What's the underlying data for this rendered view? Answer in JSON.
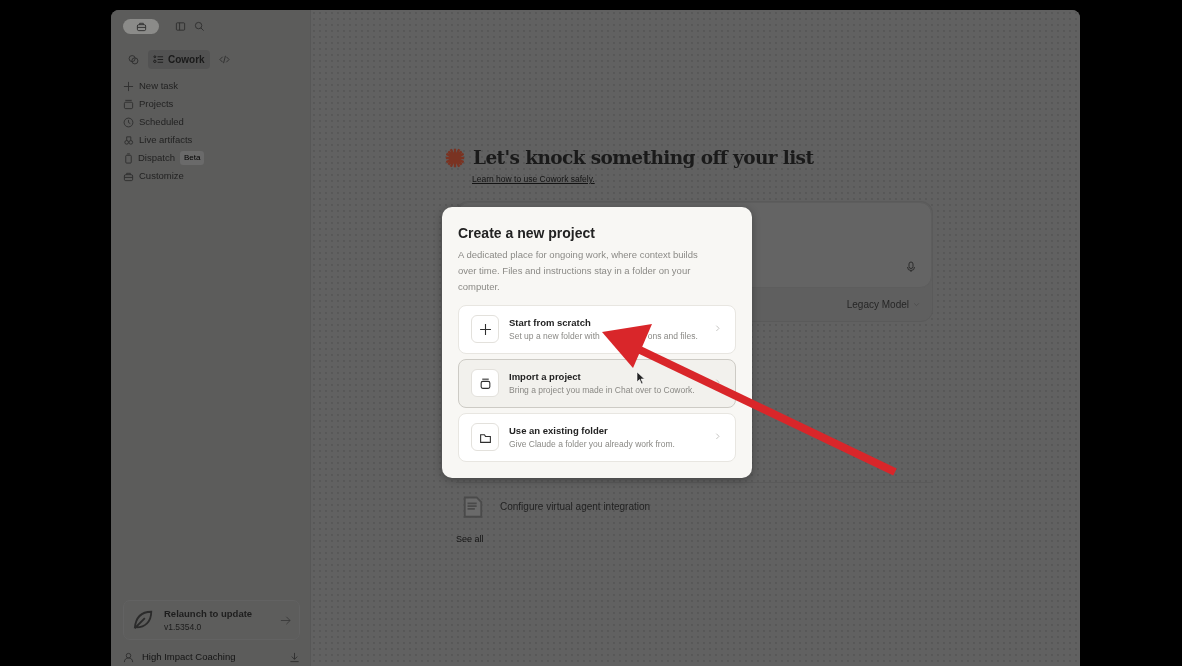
{
  "sidebar": {
    "mode_tabs": [
      {
        "kind": "chat",
        "selected": false
      },
      {
        "kind": "cowork",
        "label": "Cowork",
        "selected": true
      },
      {
        "kind": "code",
        "selected": false
      }
    ],
    "nav_items": [
      {
        "kind": "plus",
        "label": "New task"
      },
      {
        "kind": "projects",
        "label": "Projects"
      },
      {
        "kind": "clock",
        "label": "Scheduled"
      },
      {
        "kind": "artifacts",
        "label": "Live artifacts"
      },
      {
        "kind": "dispatch",
        "label": "Dispatch",
        "badge": "Beta"
      },
      {
        "kind": "customize",
        "label": "Customize"
      }
    ],
    "update_card": {
      "title": "Relaunch to update",
      "version": "v1.5354.0"
    },
    "footer_item": {
      "label": "High Impact Coaching"
    }
  },
  "main": {
    "heading": "Let's knock something off your list",
    "safety_link": "Learn how to use Cowork safely.",
    "composer": {
      "model": "Legacy Model"
    },
    "recent": {
      "items": [
        {
          "label": "Configure virtual agent integration"
        }
      ],
      "see_all": "See all"
    }
  },
  "modal": {
    "title": "Create a new project",
    "description": "A dedicated place for ongoing work, where context builds over time. Files and instructions stay in a folder on your computer.",
    "options": [
      {
        "kind": "plus",
        "title": "Start from scratch",
        "description": "Set up a new folder with",
        "description_tail": "ons and files.",
        "hovered": false
      },
      {
        "kind": "import",
        "title": "Import a project",
        "description": "Bring a project you made in Chat over to Cowork.",
        "hovered": true
      },
      {
        "kind": "folder",
        "title": "Use an existing folder",
        "description": "Give Claude a folder you already work from.",
        "hovered": false
      }
    ]
  }
}
